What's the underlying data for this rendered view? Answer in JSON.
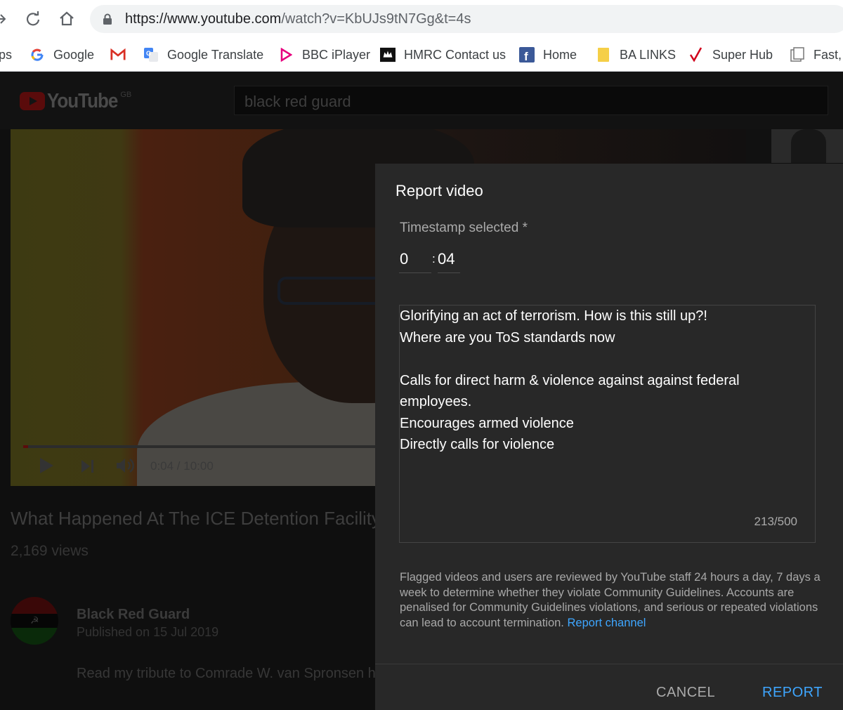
{
  "browser": {
    "url_main": "https://www.youtube.com",
    "url_rest": "/watch?v=KbUJs9tN7Gg&t=4s",
    "bookmarks": [
      {
        "label": "ps",
        "icon": "apps-icon"
      },
      {
        "label": "Google",
        "icon": "google-icon"
      },
      {
        "label": "",
        "icon": "gmail-icon"
      },
      {
        "label": "Google Translate",
        "icon": "google-translate-icon"
      },
      {
        "label": "BBC iPlayer",
        "icon": "bbc-iplayer-icon"
      },
      {
        "label": "HMRC Contact us",
        "icon": "hmrc-crest-icon"
      },
      {
        "label": "Home",
        "icon": "facebook-icon"
      },
      {
        "label": "BA LINKS",
        "icon": "folder-icon"
      },
      {
        "label": "Super Hub",
        "icon": "super-hub-icon"
      },
      {
        "label": "Fast,",
        "icon": "page-icon"
      }
    ]
  },
  "youtube": {
    "logo_text": "YouTube",
    "region": "GB",
    "search_query": "black red guard",
    "player": {
      "time": "0:04 / 10:00",
      "progress_fraction": 0.0067
    },
    "video_title": "What Happened At The ICE Detention Facility",
    "views": "2,169 views",
    "channel_name": "Black Red Guard",
    "published": "Published on 15 Jul 2019",
    "description": "Read my tribute to Comrade W. van Spronsen h"
  },
  "report_dialog": {
    "title": "Report video",
    "timestamp_label": "Timestamp selected *",
    "timestamp_minutes": "0",
    "timestamp_colon": ":",
    "timestamp_seconds": "04",
    "details_lines": [
      "Glorifying an act of terrorism. How is this still up?!",
      "Where are you ToS standards now",
      "",
      "Calls for direct harm & violence against against federal",
      "employees.",
      "Encourages armed violence",
      "Directly calls for violence"
    ],
    "char_count": "213/500",
    "disclaimer": "Flagged videos and users are reviewed by YouTube staff 24 hours a day, 7 days a week to determine whether they violate Community Guidelines. Accounts are penalised for Community Guidelines violations, and serious or repeated violations can lead to account termination.",
    "report_channel_link": "Report channel",
    "cancel_label": "CANCEL",
    "report_label": "REPORT"
  },
  "colors": {
    "dialog_bg": "#282828",
    "link_blue": "#3ea6ff",
    "page_bg": "#0f0f0f"
  }
}
